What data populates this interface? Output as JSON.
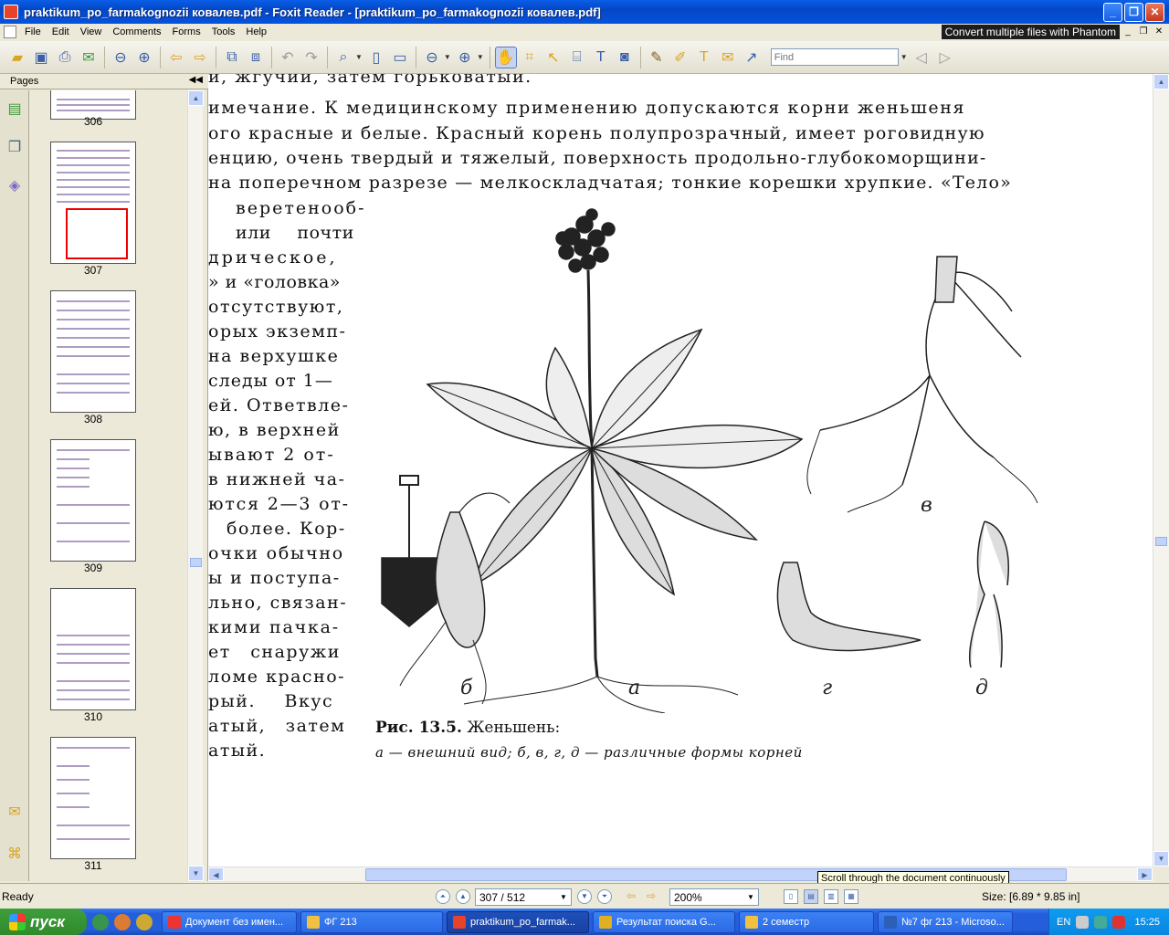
{
  "window": {
    "title": "praktikum_po_farmakognozii ковалев.pdf - Foxit Reader - [praktikum_po_farmakognozii ковалев.pdf]"
  },
  "menu": [
    "File",
    "Edit",
    "View",
    "Comments",
    "Forms",
    "Tools",
    "Help"
  ],
  "banner": "Convert multiple files with Phantom",
  "toolbar": {
    "find_placeholder": "Find"
  },
  "pages_panel": {
    "title": "Pages",
    "thumbnails": [
      {
        "label": "306"
      },
      {
        "label": "307",
        "selected": true
      },
      {
        "label": "308"
      },
      {
        "label": "309"
      },
      {
        "label": "310"
      },
      {
        "label": "311"
      }
    ]
  },
  "document": {
    "top_lines": [
      "и, жгучий, затем горьковатый.",
      "имечание. К медицинскому применению допускаются корни женьшеня",
      "ого красные и белые. Красный корень полупрозрачный, имеет роговидную",
      "енцию, очень твердый и тяжелый, поверхность продольно-глубокоморщини-",
      "на поперечном разрезе — мелкоскладчатая; тонкие корешки хрупкие. «Тело»"
    ],
    "left_column": [
      "веретенооб-",
      "или почти",
      "дрическое,",
      "» и «головка»",
      "отсутствуют,",
      "орых экземп-",
      "на верхушке",
      "следы от 1—",
      "ей. Ответвле-",
      "ю, в верхней",
      "ывают 2 от-",
      "в нижней ча-",
      "ются 2—3 от-",
      "более. Кор-",
      "очки обычно",
      "ы и поступа-",
      "льно, связан-",
      "кими пачка-",
      "ет снаружи",
      "ломе красно-",
      "рый. Вкус",
      "атый, затем",
      "атый."
    ],
    "figure": {
      "labels": [
        "б",
        "а",
        "в",
        "г",
        "д"
      ],
      "caption_title": "Рис. 13.5.",
      "caption_name": "Женьшень:",
      "caption_desc": "а — внешний вид; б, в, г, д — различные формы корней"
    }
  },
  "tooltip": "Scroll through the document continuously",
  "status": {
    "ready": "Ready",
    "page": "307 / 512",
    "zoom": "200%",
    "size": "Size: [6.89 * 9.85 in]"
  },
  "taskbar": {
    "start": "пуск",
    "tasks": [
      {
        "label": "Документ без имен..."
      },
      {
        "label": "ФГ 213"
      },
      {
        "label": "praktikum_po_farmak...",
        "active": true
      },
      {
        "label": "Результат поиска G..."
      },
      {
        "label": "2 семестр"
      },
      {
        "label": "№7 фг 213 - Microso..."
      }
    ],
    "lang": "EN",
    "clock": "15:25"
  }
}
